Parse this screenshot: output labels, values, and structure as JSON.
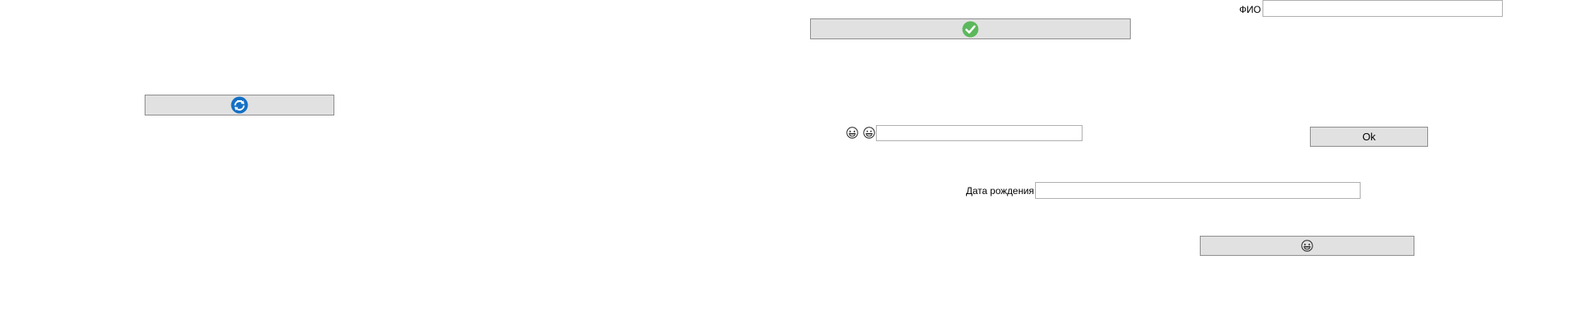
{
  "form": {
    "fio_label": "ФИО",
    "fio_value": "",
    "birth_label": "Дата рождения",
    "birth_value": "",
    "emoji_value": "",
    "ok_label": "Ok"
  },
  "icons": {
    "confirm": "green-check-icon",
    "refresh": "blue-refresh-icon",
    "emoji_laugh": "laughing-face-icon",
    "emoji_smile": "smiling-face-icon",
    "emoji_button": "laughing-face-icon"
  },
  "colors": {
    "button_bg": "#e1e1e1",
    "button_border": "#8c8c8c",
    "input_border": "#aeaeae",
    "check_green": "#5cb85c",
    "refresh_blue": "#1470c4"
  }
}
